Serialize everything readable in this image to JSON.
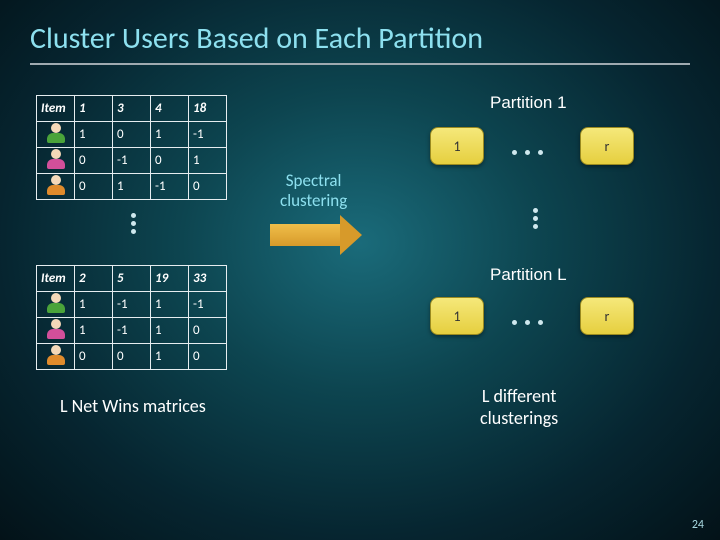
{
  "title": "Cluster Users Based on Each Partition",
  "table1": {
    "header": [
      "Item",
      "1",
      "3",
      "4",
      "18"
    ],
    "rows": [
      [
        "1",
        "0",
        "1",
        "-1"
      ],
      [
        "0",
        "-1",
        "0",
        "1"
      ],
      [
        "0",
        "1",
        "-1",
        "0"
      ]
    ]
  },
  "table2": {
    "header": [
      "Item",
      "2",
      "5",
      "19",
      "33"
    ],
    "rows": [
      [
        "1",
        "-1",
        "1",
        "-1"
      ],
      [
        "1",
        "-1",
        "1",
        "0"
      ],
      [
        "0",
        "0",
        "1",
        "0"
      ]
    ]
  },
  "partitions": {
    "p1_label": "Partition 1",
    "pL_label": "Partition L",
    "box_left": "1",
    "box_right": "r"
  },
  "spectral": {
    "line1": "Spectral",
    "line2": "clustering"
  },
  "captions": {
    "left": "L Net Wins matrices",
    "right_line1": "L different",
    "right_line2": "clusterings"
  },
  "slide_number": "24"
}
